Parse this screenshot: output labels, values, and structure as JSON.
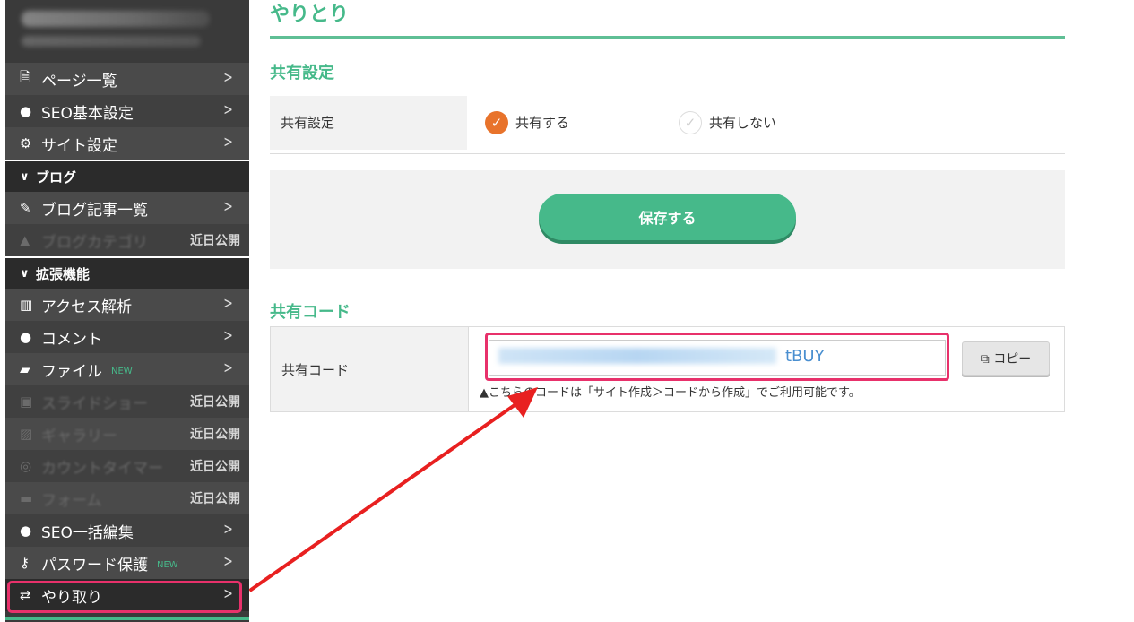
{
  "sidebar": {
    "top_items": [
      {
        "icon": "page-icon",
        "glyph": "🗎",
        "label": "ページ一覧"
      },
      {
        "icon": "globe-icon",
        "glyph": "●",
        "label": "SEO基本設定"
      },
      {
        "icon": "gear-icon",
        "glyph": "⚙",
        "label": "サイト設定"
      }
    ],
    "blog_group": "ブログ",
    "blog_items": [
      {
        "icon": "edit-icon",
        "glyph": "✎",
        "label": "ブログ記事一覧"
      },
      {
        "icon": "category-icon",
        "glyph": "▲",
        "label": "ブログカテゴリ",
        "soon": "近日公開"
      }
    ],
    "ext_group": "拡張機能",
    "ext_items": [
      {
        "icon": "chart-icon",
        "glyph": "▥",
        "label": "アクセス解析"
      },
      {
        "icon": "comment-icon",
        "glyph": "●",
        "label": "コメント"
      },
      {
        "icon": "folder-icon",
        "glyph": "▰",
        "label": "ファイル",
        "new": "NEW"
      },
      {
        "icon": "slideshow-icon",
        "glyph": "▣",
        "label": "スライドショー",
        "soon": "近日公開"
      },
      {
        "icon": "gallery-icon",
        "glyph": "▨",
        "label": "ギャラリー",
        "soon": "近日公開"
      },
      {
        "icon": "timer-icon",
        "glyph": "◎",
        "label": "カウントタイマー",
        "soon": "近日公開"
      },
      {
        "icon": "form-icon",
        "glyph": "▬",
        "label": "フォーム",
        "soon": "近日公開"
      },
      {
        "icon": "globe-icon",
        "glyph": "●",
        "label": "SEO一括編集"
      },
      {
        "icon": "key-icon",
        "glyph": "⚷",
        "label": "パスワード保護",
        "new": "NEW"
      },
      {
        "icon": "exchange-icon",
        "glyph": "⇄",
        "label": "やり取り"
      }
    ]
  },
  "main": {
    "page_title": "やりとり",
    "share_section_title": "共有設定",
    "share_label": "共有設定",
    "share_on": "共有する",
    "share_off": "共有しない",
    "save_button": "保存する",
    "code_section_title": "共有コード",
    "code_label": "共有コード",
    "code_suffix": "tBUY",
    "copy_button": "コピー",
    "code_note": "▲こちらのコードは「サイト作成＞コードから作成」でご利用可能です。"
  },
  "colors": {
    "accent": "#46b98a",
    "highlight": "#e8316b",
    "check": "#e8732b"
  }
}
